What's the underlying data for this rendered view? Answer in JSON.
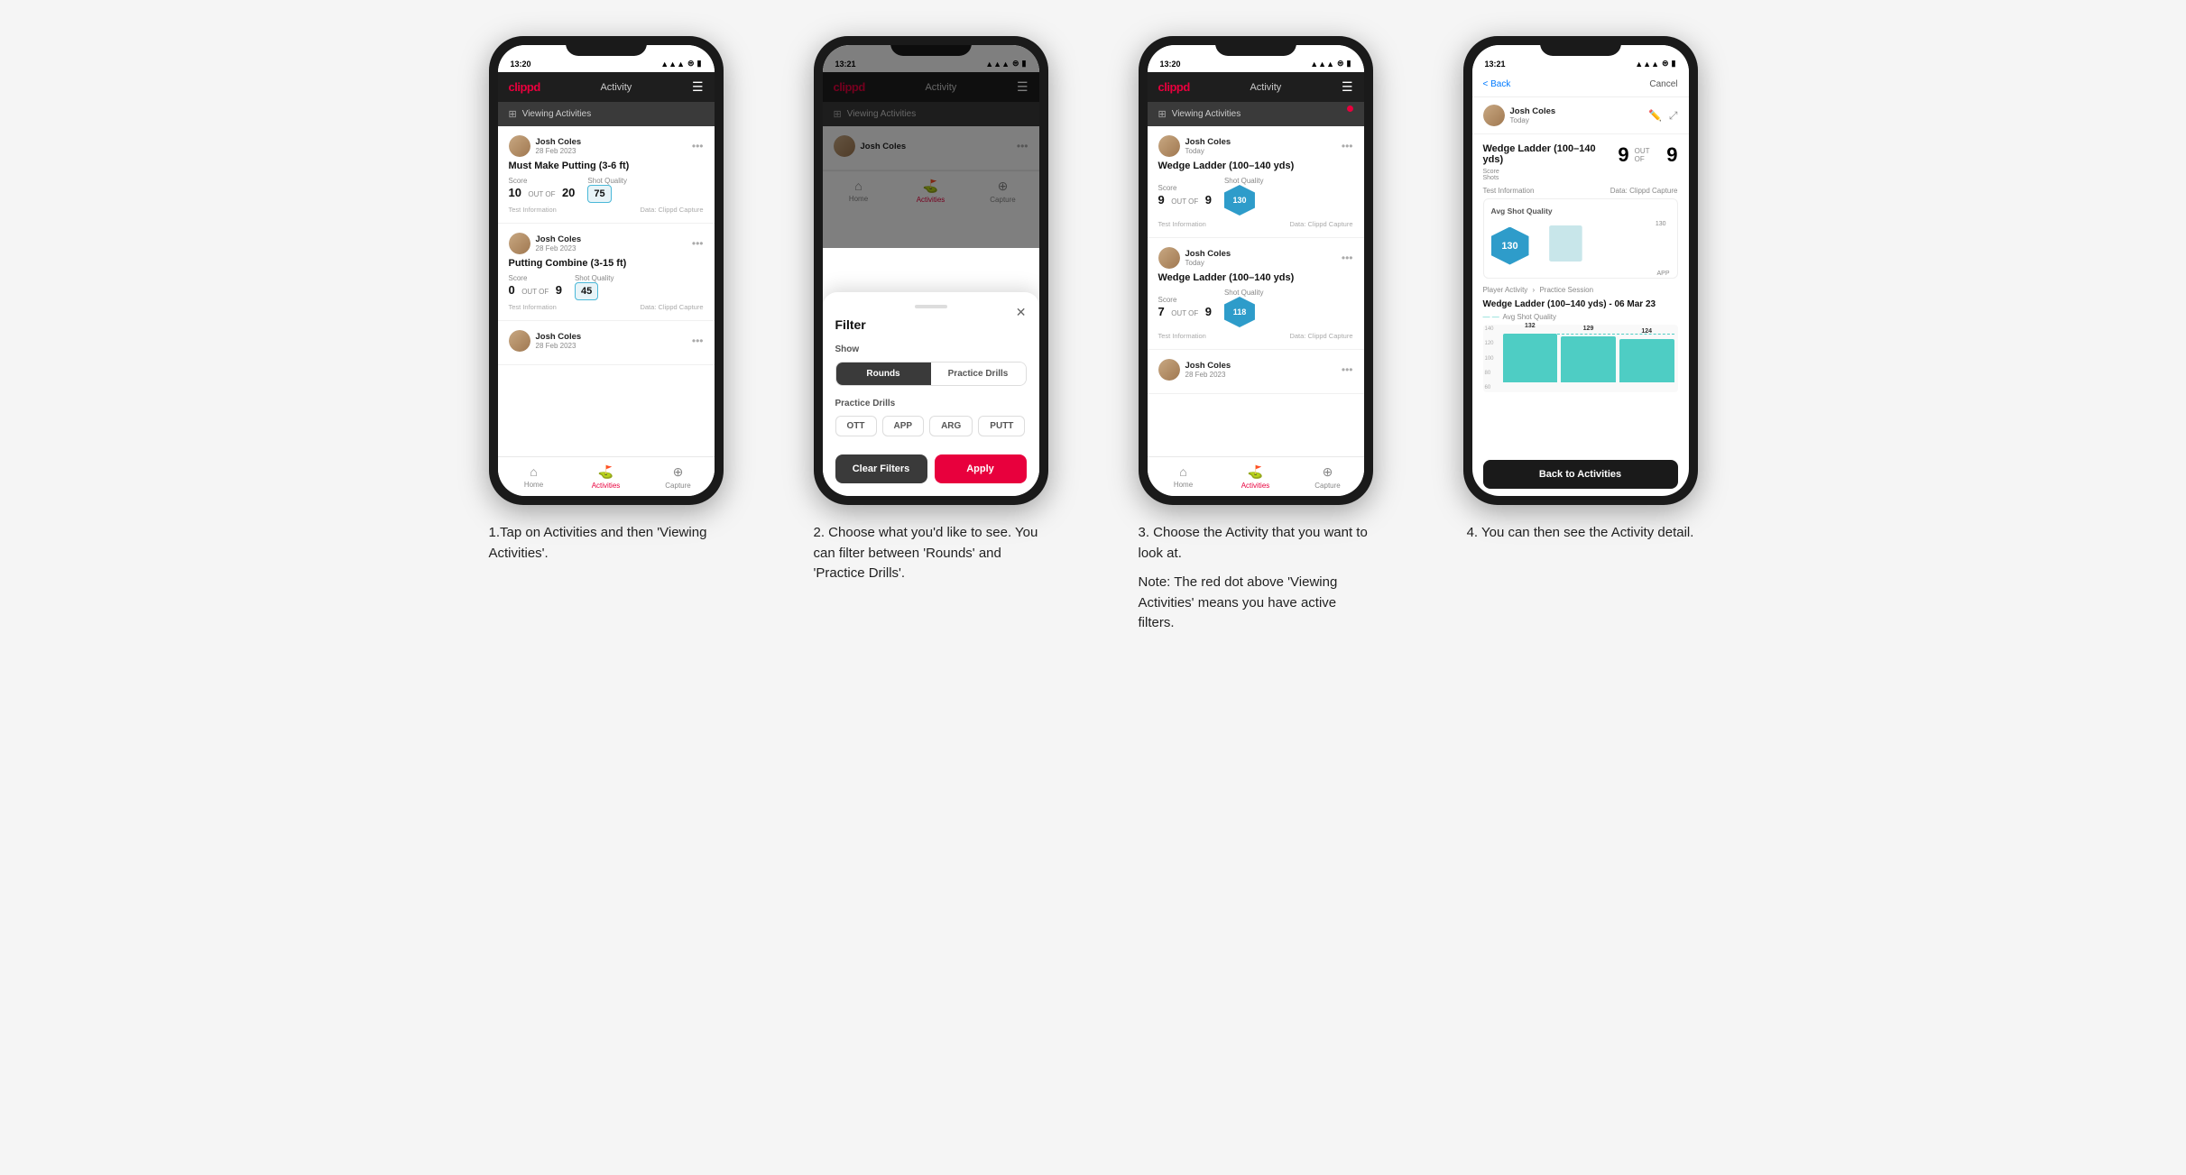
{
  "steps": [
    {
      "id": 1,
      "caption": "1.Tap on Activities and then 'Viewing Activities'.",
      "status_time": "13:20",
      "logo": "clippd",
      "header_title": "Activity",
      "viewing_bar_label": "Viewing Activities",
      "has_red_dot": false,
      "cards": [
        {
          "user_name": "Josh Coles",
          "user_date": "28 Feb 2023",
          "title": "Must Make Putting (3-6 ft)",
          "score_label": "Score",
          "score_val": "10",
          "shots_label": "Shots",
          "shots_val": "20",
          "shot_quality_label": "Shot Quality",
          "shot_quality_val": "75",
          "footer_left": "Test Information",
          "footer_right": "Data: Clippd Capture"
        },
        {
          "user_name": "Josh Coles",
          "user_date": "28 Feb 2023",
          "title": "Putting Combine (3-15 ft)",
          "score_label": "Score",
          "score_val": "0",
          "shots_label": "Shots",
          "shots_val": "9",
          "shot_quality_label": "Shot Quality",
          "shot_quality_val": "45",
          "footer_left": "Test Information",
          "footer_right": "Data: Clippd Capture"
        },
        {
          "user_name": "Josh Coles",
          "user_date": "28 Feb 2023",
          "title": "",
          "score_label": "",
          "score_val": "",
          "shots_label": "",
          "shots_val": "",
          "shot_quality_label": "",
          "shot_quality_val": "",
          "footer_left": "",
          "footer_right": ""
        }
      ],
      "nav": [
        "Home",
        "Activities",
        "Capture"
      ]
    },
    {
      "id": 2,
      "caption": "2. Choose what you'd like to see. You can filter between 'Rounds' and 'Practice Drills'.",
      "status_time": "13:21",
      "logo": "clippd",
      "header_title": "Activity",
      "viewing_bar_label": "Viewing Activities",
      "has_red_dot": false,
      "filter_modal": {
        "title": "Filter",
        "show_label": "Show",
        "toggle_options": [
          "Rounds",
          "Practice Drills"
        ],
        "active_toggle": "Rounds",
        "practice_drills_label": "Practice Drills",
        "drill_options": [
          "OTT",
          "APP",
          "ARG",
          "PUTT"
        ],
        "clear_label": "Clear Filters",
        "apply_label": "Apply"
      },
      "nav": [
        "Home",
        "Activities",
        "Capture"
      ]
    },
    {
      "id": 3,
      "caption_title": "3. Choose the Activity that you want to look at.",
      "caption_note": "Note: The red dot above 'Viewing Activities' means you have active filters.",
      "status_time": "13:20",
      "logo": "clippd",
      "header_title": "Activity",
      "viewing_bar_label": "Viewing Activities",
      "has_red_dot": true,
      "cards": [
        {
          "user_name": "Josh Coles",
          "user_date": "Today",
          "title": "Wedge Ladder (100–140 yds)",
          "score_label": "Score",
          "score_val": "9",
          "shots_label": "Shots",
          "shots_val": "9",
          "shot_quality_label": "Shot Quality",
          "shot_quality_val": "130",
          "footer_left": "Test Information",
          "footer_right": "Data: Clippd Capture"
        },
        {
          "user_name": "Josh Coles",
          "user_date": "Today",
          "title": "Wedge Ladder (100–140 yds)",
          "score_label": "Score",
          "score_val": "7",
          "shots_label": "Shots",
          "shots_val": "9",
          "shot_quality_label": "Shot Quality",
          "shot_quality_val": "118",
          "footer_left": "Test Information",
          "footer_right": "Data: Clippd Capture"
        },
        {
          "user_name": "Josh Coles",
          "user_date": "28 Feb 2023",
          "title": "",
          "score_label": "",
          "score_val": "",
          "shots_label": "",
          "shots_val": "",
          "shot_quality_label": "",
          "shot_quality_val": "",
          "footer_left": "",
          "footer_right": ""
        }
      ],
      "nav": [
        "Home",
        "Activities",
        "Capture"
      ]
    },
    {
      "id": 4,
      "caption": "4. You can then see the Activity detail.",
      "status_time": "13:21",
      "logo": "clippd",
      "back_label": "< Back",
      "cancel_label": "Cancel",
      "user_name": "Josh Coles",
      "user_date": "Today",
      "detail_title": "Wedge Ladder (100–140 yds)",
      "score_label": "Score",
      "shots_label": "Shots",
      "score_val": "9",
      "shots_val": "9",
      "out_of_label": "OUT OF",
      "avg_sq_title": "Avg Shot Quality",
      "avg_sq_val": "130",
      "chart_label": "APP",
      "chart_values": [
        132,
        129,
        124
      ],
      "chart_y_labels": [
        "140",
        "120",
        "100",
        "80",
        "60"
      ],
      "player_activity_label": "Player Activity",
      "practice_session_label": "Practice Session",
      "session_title": "Wedge Ladder (100–140 yds) - 06 Mar 23",
      "session_metric": "Avg Shot Quality",
      "back_to_label": "Back to Activities",
      "test_info": "Test Information",
      "data_label": "Data: Clippd Capture"
    }
  ],
  "colors": {
    "brand_red": "#e8003d",
    "brand_dark": "#1e1e1e",
    "teal": "#4ecdc4",
    "blue": "#2e9cca",
    "light_bg": "#f5f5f5"
  }
}
